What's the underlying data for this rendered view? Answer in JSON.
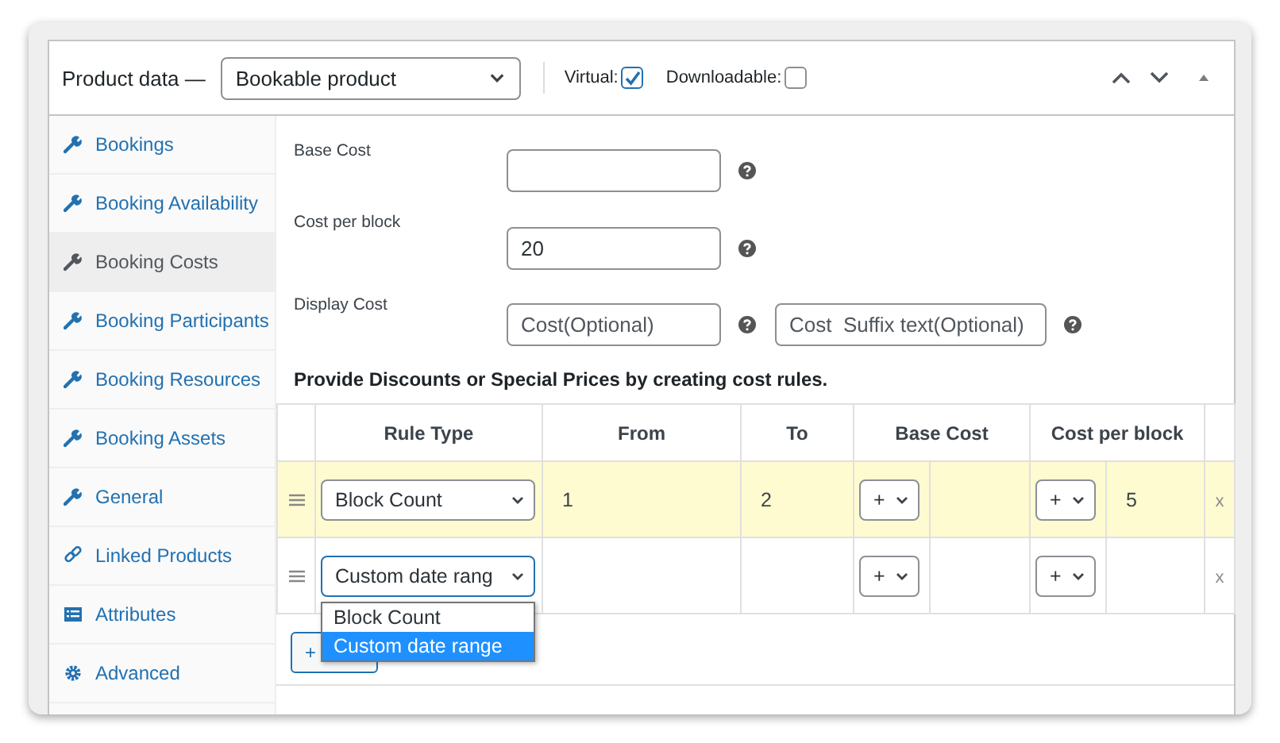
{
  "header": {
    "title": "Product data —",
    "product_type": "Bookable product",
    "virtual": {
      "label": "Virtual:",
      "checked": true
    },
    "downloadable": {
      "label": "Downloadable:",
      "checked": false
    }
  },
  "sidebar": {
    "items": [
      {
        "label": "Bookings",
        "kind": "wrench",
        "selected": false
      },
      {
        "label": "Booking Availability",
        "kind": "wrench",
        "selected": false
      },
      {
        "label": "Booking Costs",
        "kind": "wrench",
        "selected": true
      },
      {
        "label": "Booking Participants",
        "kind": "wrench",
        "selected": false
      },
      {
        "label": "Booking Resources",
        "kind": "wrench",
        "selected": false
      },
      {
        "label": "Booking Assets",
        "kind": "wrench",
        "selected": false
      },
      {
        "label": "General",
        "kind": "wrench",
        "selected": false
      },
      {
        "label": "Linked Products",
        "kind": "link",
        "selected": false
      },
      {
        "label": "Attributes",
        "kind": "list",
        "selected": false
      },
      {
        "label": "Advanced",
        "kind": "gear",
        "selected": false
      }
    ]
  },
  "fields": [
    {
      "label": "Base Cost",
      "inputs": [
        {
          "kind": "text"
        }
      ]
    },
    {
      "label": "Cost per block",
      "inputs": [
        {
          "kind": "text",
          "value": "20"
        }
      ]
    },
    {
      "label": "Display Cost",
      "inputs": [
        {
          "kind": "text",
          "placeholder": "Cost(Optional)"
        },
        {
          "kind": "text",
          "placeholder": "Cost  Suffix text(Optional)"
        }
      ]
    }
  ],
  "rules_heading": "Provide Discounts or Special Prices by creating cost rules.",
  "table": {
    "columns": [
      "Rule Type",
      "From",
      "To",
      "Base Cost",
      "Cost per block"
    ],
    "rows": [
      {
        "rule_type": "Block Count",
        "from": "1",
        "to": "2",
        "base_cost_operator": "+",
        "cost_per_block_operator": "+",
        "cost_per_block": "5",
        "remove": "x",
        "highlighted": true,
        "focused": false
      },
      {
        "rule_type": "Custom date rang",
        "base_cost_operator": "+",
        "cost_per_block_operator": "+",
        "remove": "x",
        "highlighted": false,
        "focused": true,
        "dropdown": [
          {
            "label": "Block Count",
            "selected": false
          },
          {
            "label": "Custom date range",
            "selected": true
          }
        ]
      }
    ]
  },
  "add_button": "+"
}
